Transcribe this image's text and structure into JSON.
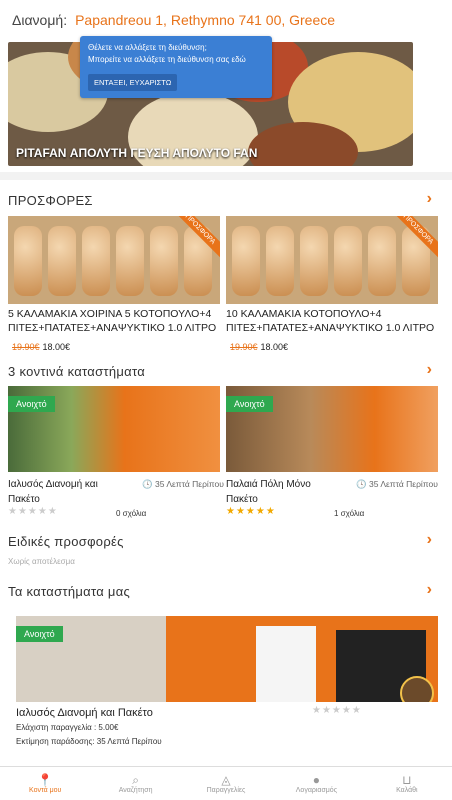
{
  "delivery": {
    "label": "Διανομή:",
    "address": "Papandreou 1, Rethymno 741 00, Greece"
  },
  "tooltip": {
    "line1": "Θέλετε να αλλάξετε τη διεύθυνση;",
    "line2": "Μπορείτε να αλλάξετε τη διεύθυνση σας εδώ",
    "ok_label": "ΕΝΤΑΞΕΙ, ΕΥΧΑΡΙΣΤΩ"
  },
  "hero": {
    "caption": "PITAFAN ΑΠΟΛΥΤΗ ΓΕΥΣΗ ΑΠΟΛΥΤΟ FAN"
  },
  "offers": {
    "title": "ΠΡΟΣΦΟΡΕΣ",
    "ribbon": "ΠΡΟΣΦΟΡΑ",
    "items": [
      {
        "title": "5 ΚΑΛΑΜΑΚΙΑ ΧΟΙΡΙΝΑ 5 ΚΟΤΟΠΟΥΛΟ+4 ΠΙΤΕΣ+ΠΑΤΑΤΕΣ+ΑΝΑΨΥΚΤΙΚΟ 1.0 ΛΙΤΡΟ",
        "old_price": "19.90€",
        "new_price": "18.00€"
      },
      {
        "title": "10 ΚΑΛΑΜΑΚΙΑ ΚΟΤΟΠΟΥΛΟ+4 ΠΙΤΕΣ+ΠΑΤΑΤΕΣ+ΑΝΑΨΥΚΤΙΚΟ 1.0 ΛΙΤΡΟ",
        "old_price": "19.90€",
        "new_price": "18.00€"
      }
    ]
  },
  "nearby": {
    "title": "3 κοντινά καταστήματα",
    "open_label": "Ανοιχτό",
    "stores": [
      {
        "name": "Ιαλυσός Διανομή και Πακέτο",
        "time": "35 Λεπτά Περίπου",
        "rating": 0,
        "reviews": "0 σχόλια"
      },
      {
        "name": "Παλαιά Πόλη Μόνο Πακέτο",
        "time": "35 Λεπτά Περίπου",
        "rating": 5,
        "reviews": "1 σχόλια"
      }
    ]
  },
  "special": {
    "title": "Ειδικές προσφορές",
    "empty": "Χωρίς αποτέλεσμα"
  },
  "our_stores": {
    "title": "Τα καταστήματα μας",
    "open_label": "Ανοιχτό",
    "store": {
      "name": "Ιαλυσός Διανομή και Πακέτο",
      "min_order": "Ελάχιστη παραγγελία : 5.00€",
      "delivery_time": "Εκτίμηση παράδοσης: 35 Λεπτά Περίπου",
      "rating": 0
    }
  },
  "nav": [
    {
      "label": "Κοντά μου",
      "icon": "location-pin-icon",
      "active": true
    },
    {
      "label": "Αναζήτηση",
      "icon": "search-icon",
      "active": false
    },
    {
      "label": "Παραγγελίες",
      "icon": "pizza-slice-icon",
      "active": false
    },
    {
      "label": "Λογαριασμός",
      "icon": "user-icon",
      "active": false
    },
    {
      "label": "Καλάθι",
      "icon": "basket-icon",
      "active": false
    }
  ],
  "colors": {
    "accent": "#e8731a",
    "open": "#2fa84f",
    "tooltip": "#3b7fd4",
    "star": "#f2a900"
  }
}
